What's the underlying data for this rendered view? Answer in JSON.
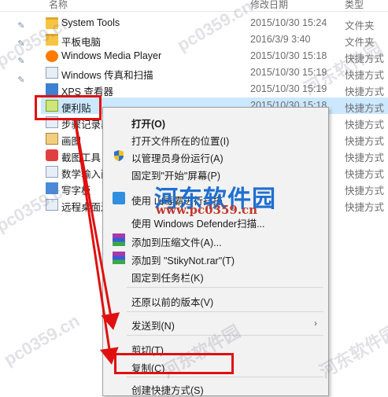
{
  "header": {
    "name": "名称",
    "date": "修改日期",
    "type": "类型"
  },
  "rows": [
    {
      "name": "System Tools",
      "date": "2015/10/30 15:24",
      "type": "文件夹"
    },
    {
      "name": "平板电脑",
      "date": "2016/3/9 3:40",
      "type": "文件夹"
    },
    {
      "name": "Windows Media Player",
      "date": "2015/10/30 15:18",
      "type": "快捷方式"
    },
    {
      "name": "Windows 传真和扫描",
      "date": "2015/10/30 15:19",
      "type": "快捷方式"
    },
    {
      "name": "XPS 查看器",
      "date": "2015/10/30 15:19",
      "type": "快捷方式"
    },
    {
      "name": "便利贴",
      "date": "2015/10/30 15:18",
      "type": "快捷方式"
    },
    {
      "name": "步骤记录器",
      "date": "",
      "type": "快捷方式"
    },
    {
      "name": "画图",
      "date": "",
      "type": "快捷方式"
    },
    {
      "name": "截图工具",
      "date": "",
      "type": "快捷方式"
    },
    {
      "name": "数学输入面板",
      "date": "",
      "type": "快捷方式"
    },
    {
      "name": "写字板",
      "date": "",
      "type": "快捷方式"
    },
    {
      "name": "远程桌面连接",
      "date": "",
      "type": "快捷方式"
    }
  ],
  "menu": {
    "open": "打开(O)",
    "open_location": "打开文件所在的位置(I)",
    "run_admin": "以管理员身份运行(A)",
    "pin_start": "固定到\"开始\"屏幕(P)",
    "scan_guard": "使用 山毒霸进行扫描",
    "defender": "使用 Windows Defender扫描...",
    "add_archive": "添加到压缩文件(A)...",
    "add_rar": "添加到 \"StikyNot.rar\"(T)",
    "pin_taskbar": "固定到任务栏(K)",
    "restore": "还原以前的版本(V)",
    "send_to": "发送到(N)",
    "cut": "剪切(T)",
    "copy": "复制(C)",
    "create_shortcut": "创建快捷方式(S)"
  },
  "watermark": {
    "logo": "河东软件园",
    "url": "www.pc0359.cn",
    "tile": "pc0359.cn",
    "tile2": "河东软件园"
  },
  "colors": {
    "selection": "#cce8ff",
    "annotation": "#e01010",
    "menu_bg": "#f2f2f2"
  }
}
